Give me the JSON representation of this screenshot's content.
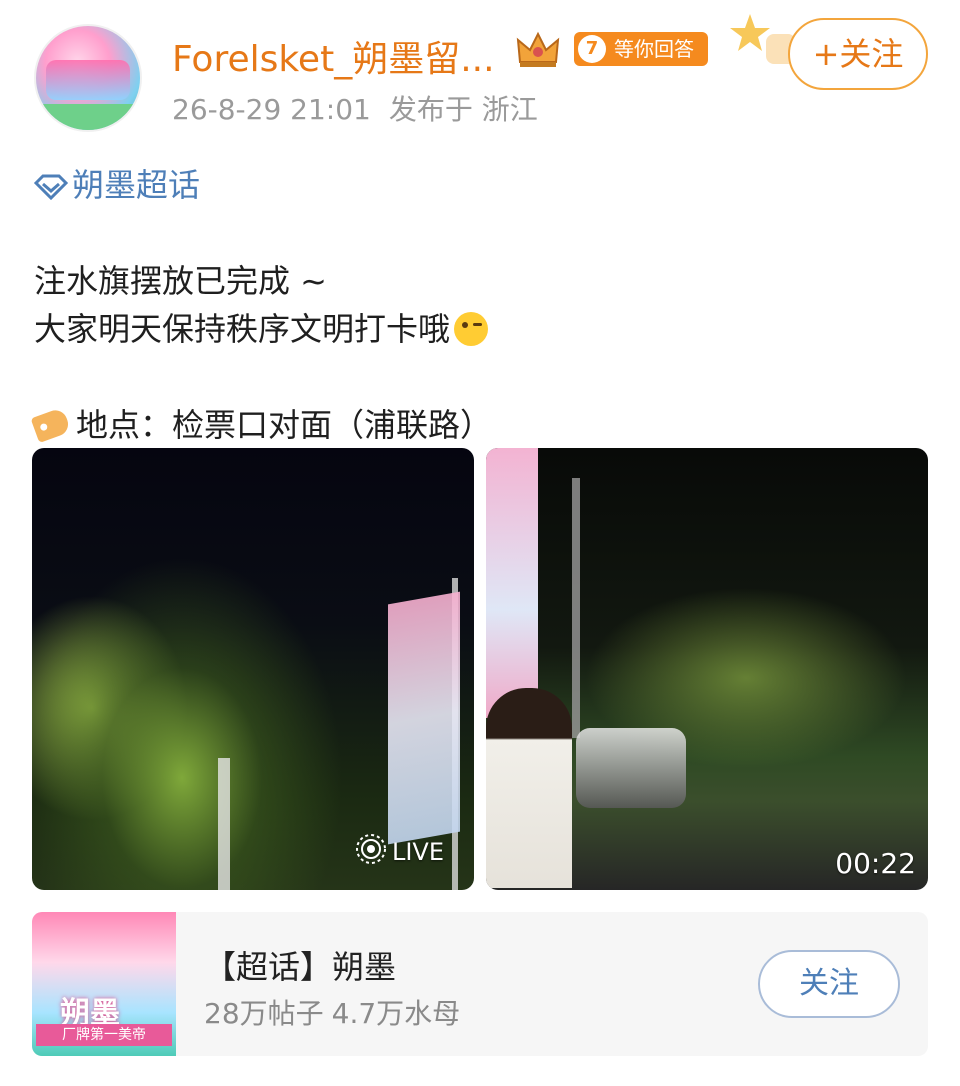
{
  "header": {
    "username": "Forelsket_朔墨留...",
    "badge_level": "7",
    "badge_text": "等你回答",
    "follow_label": "+关注",
    "timestamp": "26-8-29 21:01",
    "location_meta": "发布于 浙江"
  },
  "topic_link": "朔墨超话",
  "post": {
    "line1": "注水旗摆放已完成 ~",
    "line2": "大家明天保持秩序文明打卡哦",
    "location_line": "地点：检票口对面（浦联路）"
  },
  "media": {
    "left_label": "LIVE",
    "right_duration": "00:22"
  },
  "supertopic_card": {
    "thumb_title": "朔墨",
    "thumb_subtitle": "厂牌第一美帝",
    "title": "【超话】朔墨",
    "posts": "28万帖子",
    "members": "4.7万水母",
    "follow_label": "关注"
  },
  "colors": {
    "username": "#e67817",
    "link_blue": "#4e7fb8",
    "badge_orange": "#f58a1e"
  }
}
